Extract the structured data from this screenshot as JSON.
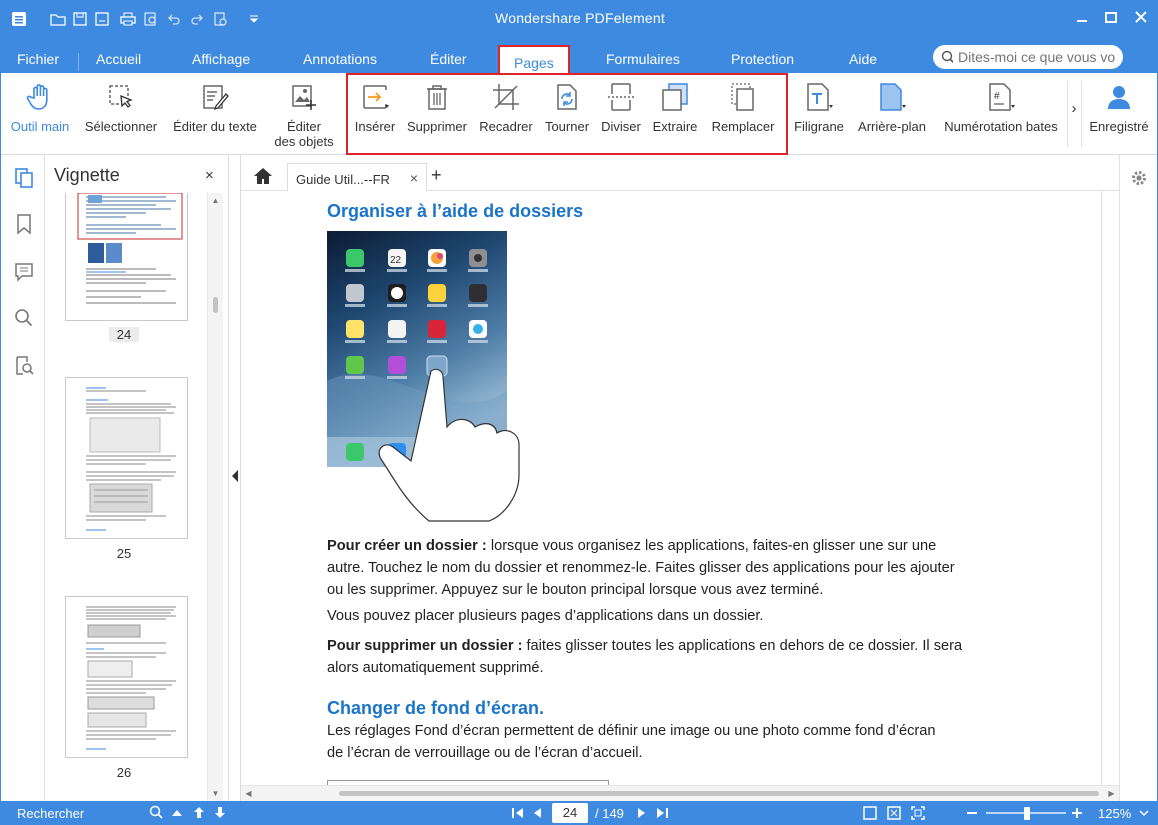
{
  "app": {
    "title": "Wondershare PDFelement"
  },
  "menu": {
    "tabs": [
      "Fichier",
      "Accueil",
      "Affichage",
      "Annotations",
      "Éditer",
      "Pages",
      "Formulaires",
      "Protection",
      "Aide"
    ],
    "active_tab": "Pages",
    "search_placeholder": "Dites-moi ce que vous vo"
  },
  "ribbon": {
    "outil_main": "Outil main",
    "selectionner": "Sélectionner",
    "editer_texte": "Éditer du texte",
    "editer_objets_1": "Éditer",
    "editer_objets_2": "des objets",
    "inserer": "Insérer",
    "supprimer": "Supprimer",
    "recadrer": "Recadrer",
    "tourner": "Tourner",
    "diviser": "Diviser",
    "extraire": "Extraire",
    "remplacer": "Remplacer",
    "filigrane": "Filigrane",
    "arriere_plan": "Arrière-plan",
    "numerotation": "Numérotation bates",
    "more": "›",
    "enregistre": "Enregistré"
  },
  "thumbnails": {
    "title": "Vignette",
    "close": "×",
    "pages": [
      "24",
      "25",
      "26"
    ],
    "selected": "24"
  },
  "doc_tab": {
    "label": "Guide Util...--FR",
    "close": "×",
    "add": "+"
  },
  "document": {
    "heading1": "Organiser à l’aide de dossiers",
    "p1_bold": "Pour créer un dossier :",
    "p1_line1": " lorsque vous organisez les applications, faites-en glisser une sur une",
    "p1_line2": "autre. Touchez le nom du dossier et renommez-le. Faites glisser des applications pour les ajouter",
    "p1_line3": "ou les supprimer. Appuyez sur le bouton principal lorsque vous avez terminé.",
    "p2": "Vous pouvez placer plusieurs pages d’applications dans un dossier.",
    "p3_bold": "Pour supprimer un dossier :",
    "p3_line1": " faites glisser toutes les applications en dehors de ce dossier. Il sera",
    "p3_line2": "alors automatiquement supprimé.",
    "heading2": "Changer de fond d’écran.",
    "p4_line1": "Les réglages Fond d’écran permettent de définir une image ou une photo comme fond d’écran",
    "p4_line2": "de l’écran de verrouillage ou de l’écran d’accueil.",
    "ipad_date": "22"
  },
  "status": {
    "search_label": "Rechercher",
    "current_page": "24",
    "total_pages": "/ 149",
    "zoom": "125%"
  },
  "colors": {
    "accent": "#3d8ae0",
    "highlight": "#e0242a",
    "heading": "#1a75c8"
  }
}
